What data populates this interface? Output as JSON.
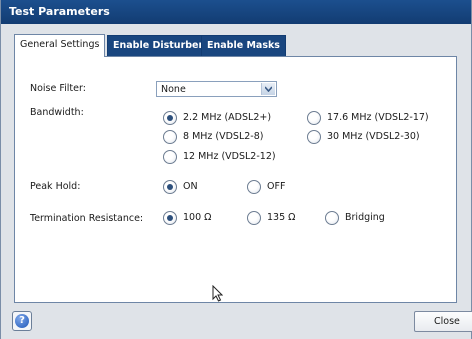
{
  "window": {
    "title": "Test Parameters"
  },
  "tabs": [
    {
      "label": "General Settings",
      "active": true
    },
    {
      "label": "Enable Disturbers",
      "active": false
    },
    {
      "label": "Enable Masks",
      "active": false
    }
  ],
  "noise_filter": {
    "label": "Noise Filter:",
    "value": "None"
  },
  "bandwidth": {
    "label": "Bandwidth:",
    "options": [
      {
        "label": "2.2 MHz (ADSL2+)",
        "selected": true
      },
      {
        "label": "17.6 MHz (VDSL2-17)",
        "selected": false
      },
      {
        "label": "8 MHz (VDSL2-8)",
        "selected": false
      },
      {
        "label": "30 MHz (VDSL2-30)",
        "selected": false
      },
      {
        "label": "12 MHz (VDSL2-12)",
        "selected": false
      }
    ]
  },
  "peak_hold": {
    "label": "Peak Hold:",
    "options": [
      {
        "label": "ON",
        "selected": true
      },
      {
        "label": "OFF",
        "selected": false
      }
    ]
  },
  "termination": {
    "label": "Termination Resistance:",
    "options": [
      {
        "label": "100 Ω",
        "selected": true
      },
      {
        "label": "135 Ω",
        "selected": false
      },
      {
        "label": "Bridging",
        "selected": false
      }
    ]
  },
  "footer": {
    "help_icon": "help-icon",
    "help_glyph": "?",
    "close_label": "Close"
  },
  "colors": {
    "titlebar": "#123c72",
    "tab_inactive": "#19467f",
    "radio_dot": "#2c4f7c"
  }
}
